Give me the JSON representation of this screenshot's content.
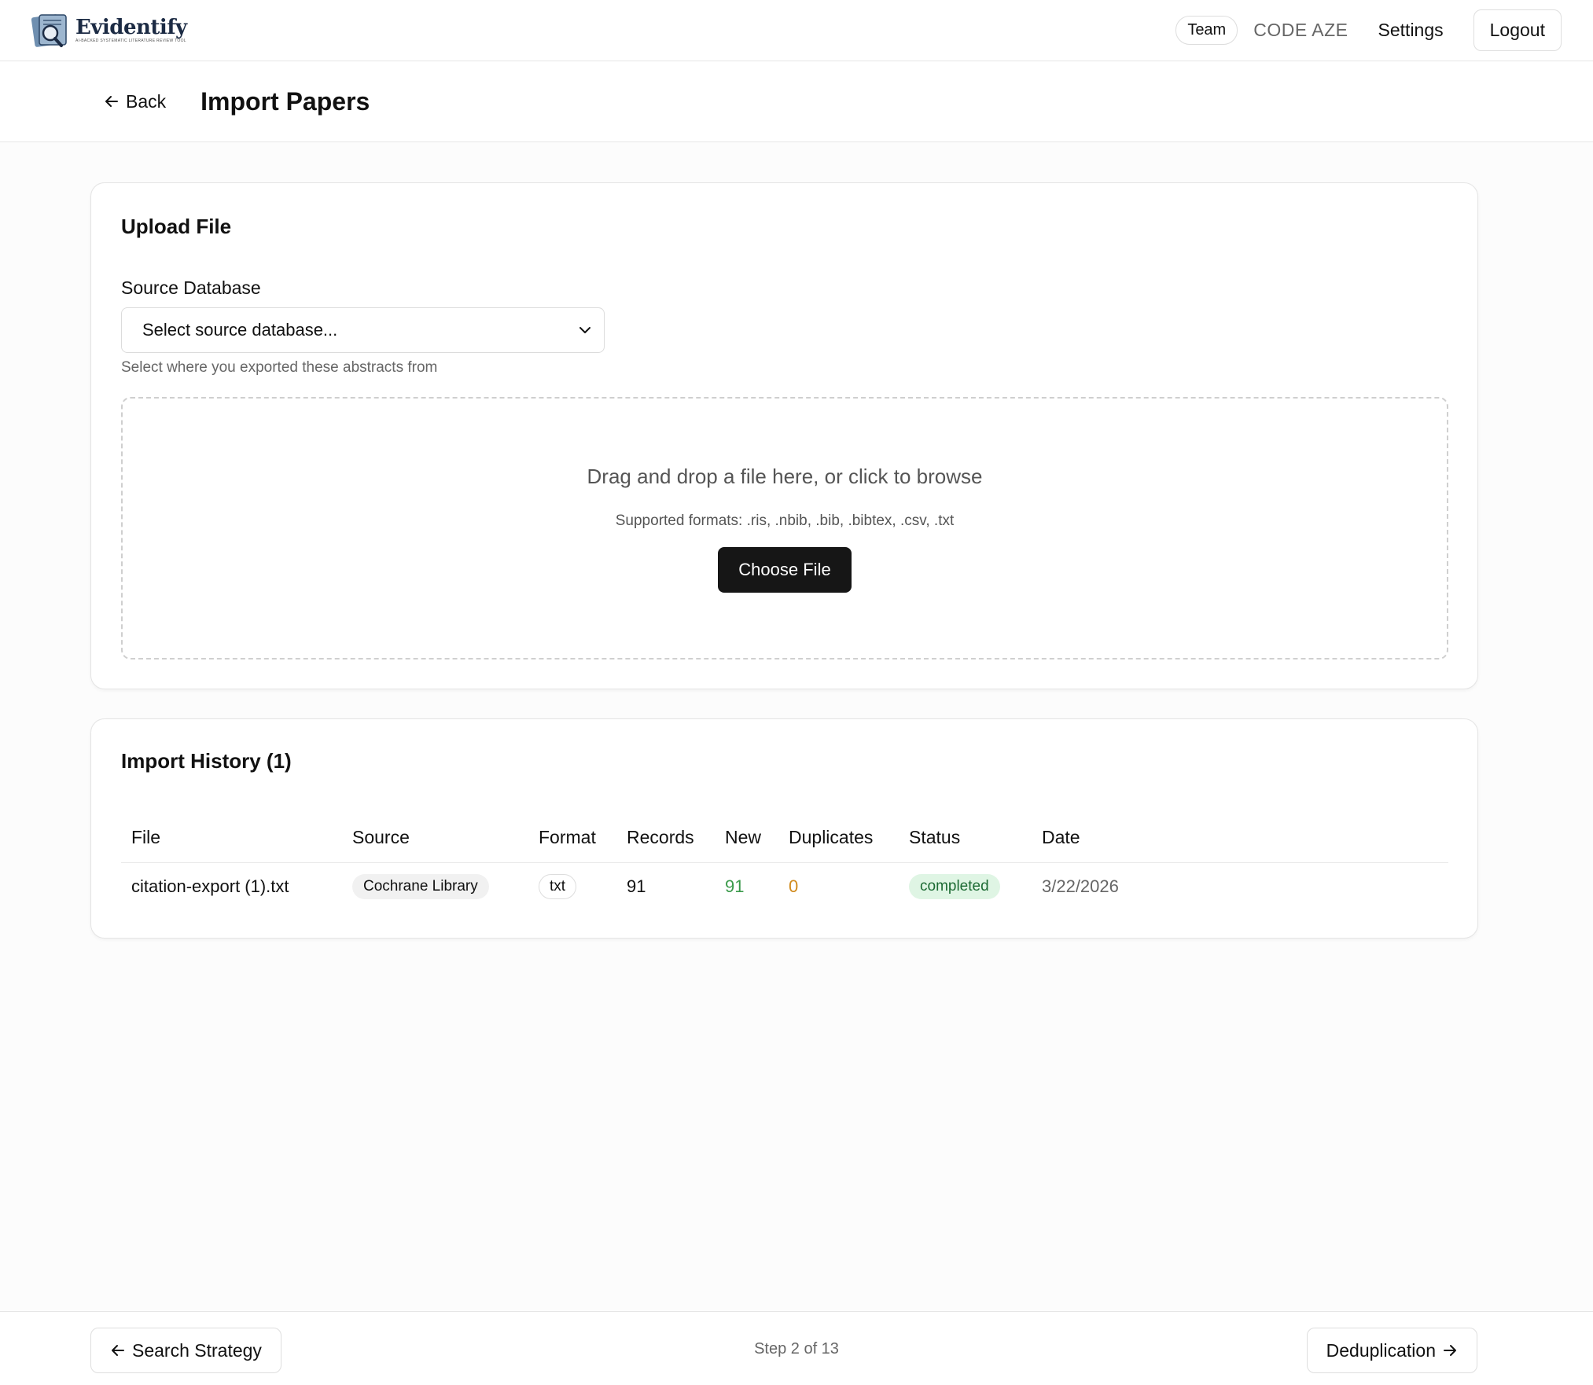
{
  "app": {
    "logo_text": "Evidentify",
    "logo_tagline": "AI-BACKED SYSTEMATIC LITERATURE REVIEW TOOL"
  },
  "nav": {
    "team_label": "Team",
    "code": "CODE AZE",
    "settings_label": "Settings",
    "logout_label": "Logout"
  },
  "header": {
    "back_label": "Back",
    "title": "Import Papers"
  },
  "upload": {
    "title": "Upload File",
    "source_label": "Source Database",
    "source_placeholder": "Select source database...",
    "source_help": "Select where you exported these abstracts from",
    "drop_text": "Drag and drop a file here, or click to browse",
    "formats_text": "Supported formats: .ris, .nbib, .bib, .bibtex, .csv, .txt",
    "choose_label": "Choose File"
  },
  "history": {
    "title": "Import History (1)",
    "columns": [
      "File",
      "Source",
      "Format",
      "Records",
      "New",
      "Duplicates",
      "Status",
      "Date"
    ],
    "rows": [
      {
        "file": "citation-export (1).txt",
        "source": "Cochrane Library",
        "format": "txt",
        "records": "91",
        "new": "91",
        "duplicates": "0",
        "status": "completed",
        "date": "3/22/2026"
      }
    ]
  },
  "footer": {
    "prev_label": "Search Strategy",
    "step_text": "Step 2 of 13",
    "next_label": "Deduplication"
  },
  "colors": {
    "primary_button": "#161616",
    "status_completed_bg": "#dff5e4",
    "status_completed_text": "#1d6b34",
    "new_value": "#3a9a4a",
    "duplicates_value": "#d08a1c"
  },
  "icons": {
    "back": "arrow-left-icon",
    "dropdown": "chevron-down-icon",
    "next": "arrow-right-icon"
  }
}
